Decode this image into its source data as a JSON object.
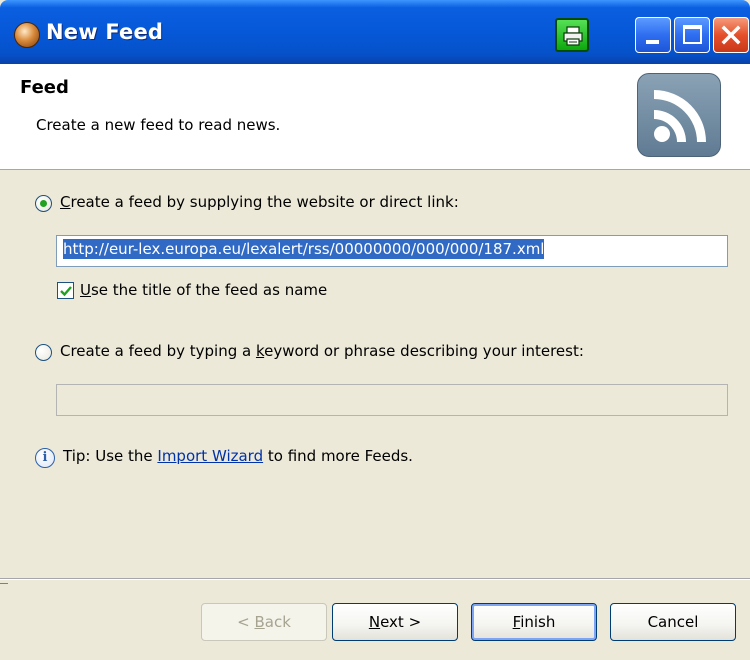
{
  "window": {
    "title": "New Feed"
  },
  "header": {
    "title": "Feed",
    "description": "Create a new feed to read news."
  },
  "options": {
    "link": {
      "label_mnemonic": "C",
      "label_rest": "reate a feed by supplying the website or direct link:",
      "selected": true
    },
    "url_value": "http://eur-lex.europa.eu/lexalert/rss/00000000/000/000/187.xml",
    "use_title": {
      "label_mnemonic": "U",
      "label_rest": "se the title of the feed as name",
      "checked": true
    },
    "keyword": {
      "label_before": "Create a feed by typing a ",
      "label_mnemonic": "k",
      "label_after": "eyword or phrase describing your interest:",
      "selected": false
    },
    "keyword_value": ""
  },
  "tip": {
    "prefix": "Tip: Use the ",
    "link": "Import Wizard",
    "suffix": " to find more Feeds."
  },
  "buttons": {
    "back_prefix": "< ",
    "back_mnemonic": "B",
    "back_rest": "ack",
    "next_mnemonic": "N",
    "next_rest": "ext >",
    "finish_mnemonic": "F",
    "finish_rest": "inish",
    "cancel": "Cancel"
  },
  "icons": {
    "app": "feed-reader-app-icon",
    "printer": "printer-icon",
    "feed_logo": "rss-icon",
    "info": "info-icon"
  },
  "colors": {
    "titlebar": "#0658d8",
    "selection": "#316ac5",
    "link": "#0033aa",
    "dialog_bg": "#ece9d8"
  }
}
